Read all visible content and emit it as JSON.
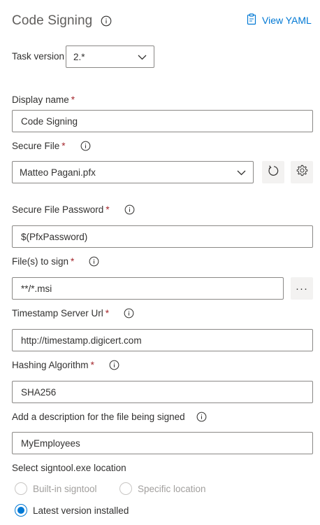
{
  "header": {
    "title": "Code Signing",
    "view_yaml_label": "View YAML"
  },
  "task_version": {
    "label": "Task version",
    "value": "2.*"
  },
  "fields": {
    "display_name": {
      "label": "Display name",
      "required_mark": "*",
      "value": "Code Signing"
    },
    "secure_file": {
      "label": "Secure File",
      "required_mark": "*",
      "value": "Matteo Pagani.pfx"
    },
    "secure_file_password": {
      "label": "Secure File Password",
      "required_mark": "*",
      "value": "$(PfxPassword)"
    },
    "files_to_sign": {
      "label": "File(s) to sign",
      "required_mark": "*",
      "value": "**/*.msi",
      "browse_label": "···"
    },
    "timestamp_server_url": {
      "label": "Timestamp Server Url",
      "required_mark": "*",
      "value": "http://timestamp.digicert.com"
    },
    "hashing_algorithm": {
      "label": "Hashing Algorithm",
      "required_mark": "*",
      "value": "SHA256"
    },
    "description": {
      "label": "Add a description for the file being signed",
      "value": "MyEmployees"
    }
  },
  "signtool_location": {
    "label": "Select signtool.exe location",
    "options": [
      {
        "label": "Built-in signtool",
        "state": "disabled"
      },
      {
        "label": "Specific location",
        "state": "disabled"
      },
      {
        "label": "Latest version installed",
        "state": "selected"
      }
    ]
  },
  "colors": {
    "accent": "#0078d4",
    "required": "#a4262c",
    "border": "#8a8886",
    "text": "#323130",
    "title": "#605e5c",
    "disabled": "#a19f9d",
    "icon_button_bg": "#f3f2f1"
  },
  "icons": {
    "info": "info-icon",
    "yaml": "clipboard-icon",
    "chevron": "chevron-down-icon",
    "refresh": "refresh-icon",
    "manage": "gear-icon"
  }
}
